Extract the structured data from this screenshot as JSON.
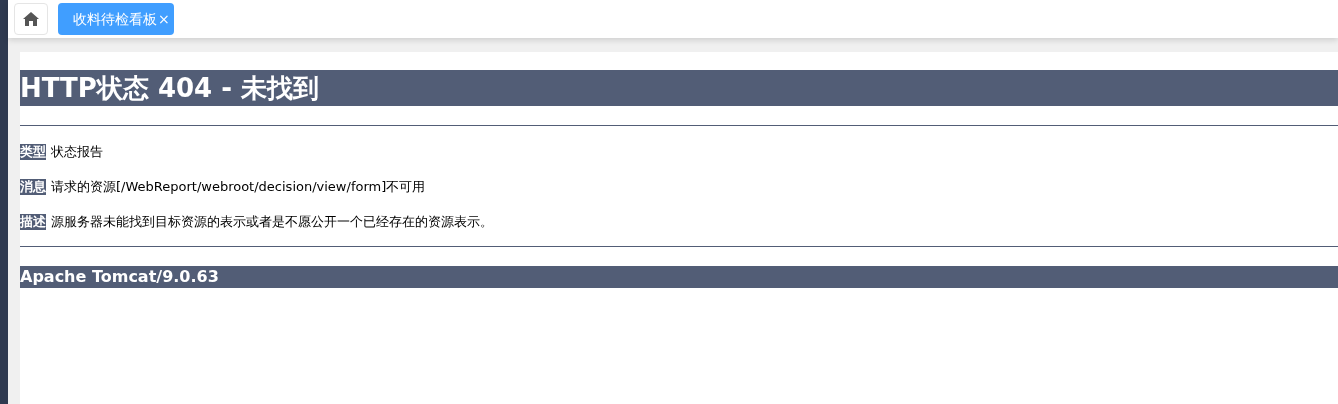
{
  "tabs": [
    {
      "label": "收料待检看板",
      "close": "×",
      "selected": true
    }
  ],
  "error_page": {
    "title": "HTTP状态 404 - 未找到",
    "fields": [
      {
        "label": "类型",
        "value": "状态报告"
      },
      {
        "label": "消息",
        "value": "请求的资源[/WebReport/webroot/decision/view/form]不可用"
      },
      {
        "label": "描述",
        "value": "源服务器未能找到目标资源的表示或者是不愿公开一个已经存在的资源表示。"
      }
    ],
    "footer": "Apache Tomcat/9.0.63"
  }
}
